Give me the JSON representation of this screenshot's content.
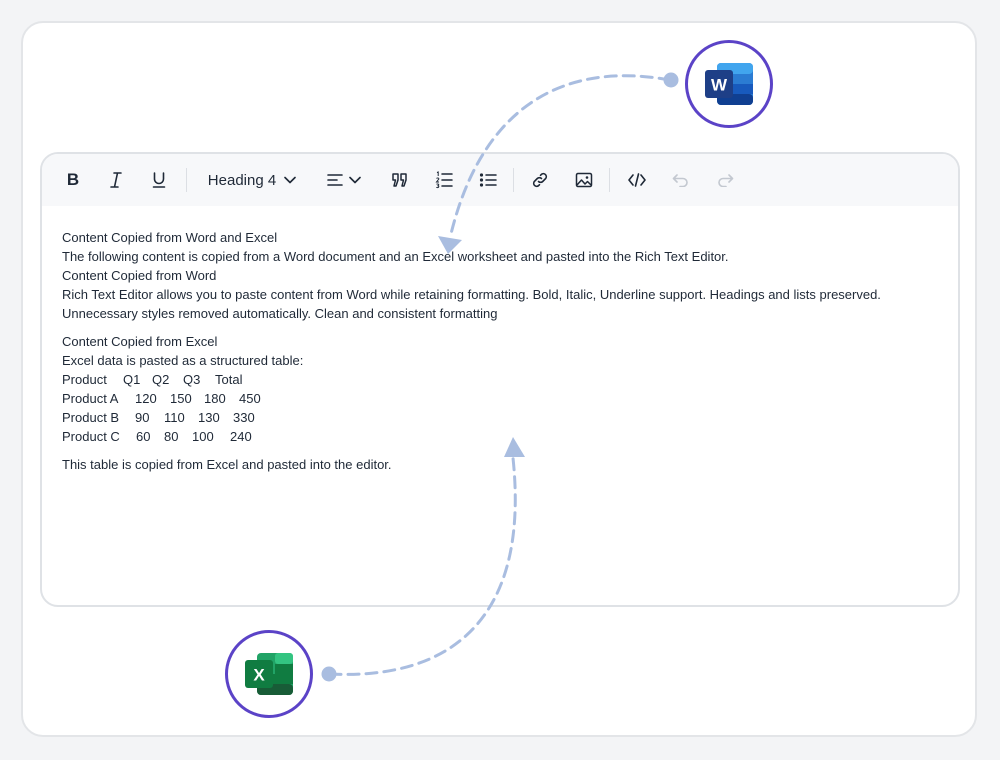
{
  "toolbar": {
    "bold_label": "B",
    "heading_value": "Heading 4"
  },
  "content": {
    "title": "Content Copied from Word and Excel",
    "intro": "The following content is copied from a Word document and an Excel worksheet and pasted into the Rich Text Editor.",
    "word_heading": "Content Copied from Word",
    "word_text1": "Rich Text Editor allows you to paste content from Word while retaining formatting. Bold, Italic, Underline support. Headings and lists preserved.",
    "word_text2": "Unnecessary styles removed automatically. Clean and consistent formatting",
    "excel_heading": "Content Copied from Excel",
    "excel_intro": "Excel data is pasted as a structured table:",
    "table": {
      "header": [
        "Product",
        "Q1",
        "Q2",
        "Q3",
        "Total"
      ],
      "rows": [
        [
          "Product A",
          "120",
          "150",
          "180",
          "450"
        ],
        [
          "Product B",
          "90",
          "110",
          "130",
          "330"
        ],
        [
          "Product C",
          "60",
          "80",
          "100",
          "240"
        ]
      ]
    },
    "footer": "This table is copied from Excel and pasted into the editor."
  },
  "apps": {
    "word_letter": "W",
    "excel_letter": "X"
  },
  "colors": {
    "badge_border": "#5b43c7",
    "arrow": "#a9bde0",
    "word_dark": "#1e3f87",
    "excel_dark": "#107c41"
  }
}
